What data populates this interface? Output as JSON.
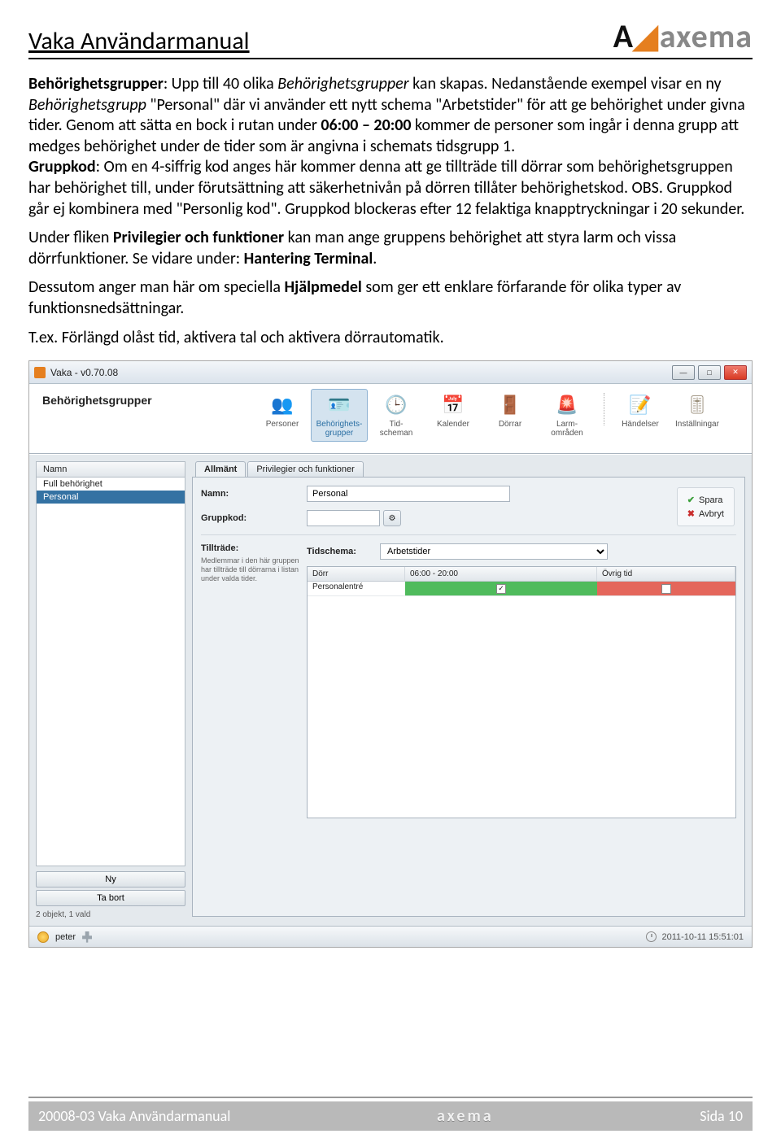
{
  "header": {
    "title": "Vaka Användarmanual",
    "logo_text": "axema"
  },
  "body": {
    "p1_a": "Behörighetsgrupper",
    "p1_b": ": Upp till 40 olika ",
    "p1_c": "Behörighetsgrupper",
    "p1_d": " kan skapas. Nedanstående exempel visar en ny ",
    "p1_e": "Behörighetsgrupp",
    "p1_f": " \"Personal\" där vi använder ett nytt schema \"Arbetstider\" för att ge behörighet under givna tider. Genom att sätta en bock i rutan under ",
    "p1_g": "06:00 – 20:00",
    "p1_h": " kommer de personer som ingår i denna grupp att medges behörighet under de tider som är angivna i schemats tidsgrupp 1.",
    "p2_a": "Gruppkod",
    "p2_b": ": Om en 4-siffrig kod anges här kommer denna att ge tillträde till dörrar som behörighetsgruppen har behörighet till, under förutsättning att säkerhetnivån på dörren tillåter behörighetskod. OBS. Gruppkod går ej kombinera med \"Personlig kod\". Gruppkod blockeras efter 12 felaktiga knapptryckningar i 20 sekunder.",
    "p3_a": "Under fliken ",
    "p3_b": "Privilegier och funktioner",
    "p3_c": " kan man ange gruppens behörighet att styra larm och vissa dörrfunktioner. Se vidare under: ",
    "p3_d": "Hantering Terminal",
    "p3_e": ".",
    "p4_a": "Dessutom anger man här om speciella ",
    "p4_b": "Hjälpmedel",
    "p4_c": " som ger ett enklare förfarande för olika typer av funktionsnedsättningar.",
    "p5": "T.ex. Förlängd olåst tid, aktivera tal och aktivera dörrautomatik."
  },
  "app": {
    "title": "Vaka - v0.70.08",
    "page_label": "Behörighetsgrupper",
    "toolbar": {
      "personer": "Personer",
      "behorig": "Behörighets-\ngrupper",
      "tidscheman": "Tid-\nscheman",
      "kalender": "Kalender",
      "dorrar": "Dörrar",
      "larm": "Larm-\nområden",
      "handelser": "Händelser",
      "installningar": "Inställningar"
    },
    "sidebar": {
      "head": "Namn",
      "items": [
        "Full behörighet",
        "Personal"
      ],
      "btn_new": "Ny",
      "btn_del": "Ta bort",
      "status": "2 objekt, 1 vald"
    },
    "tabs": {
      "t1": "Allmänt",
      "t2": "Privilegier och funktioner"
    },
    "form": {
      "namn_lbl": "Namn:",
      "namn_val": "Personal",
      "kod_lbl": "Gruppkod:",
      "tilltrade_lbl": "Tillträde:",
      "tilltrade_desc": "Medlemmar i den här gruppen har tillträde till dörrarna i listan under valda tider.",
      "tidschema_lbl": "Tidschema:",
      "tidschema_val": "Arbetstider"
    },
    "grid": {
      "h1": "Dörr",
      "h2": "06:00 - 20:00",
      "h3": "Övrig tid",
      "row1": "Personalentré",
      "row1_chk": "✓"
    },
    "actions": {
      "save": "Spara",
      "cancel": "Avbryt"
    },
    "status": {
      "user": "peter",
      "time": "2011-10-11 15:51:01"
    }
  },
  "footer": {
    "left": "20008-03 Vaka Användarmanual",
    "logo": "axema",
    "right": "Sida 10"
  }
}
